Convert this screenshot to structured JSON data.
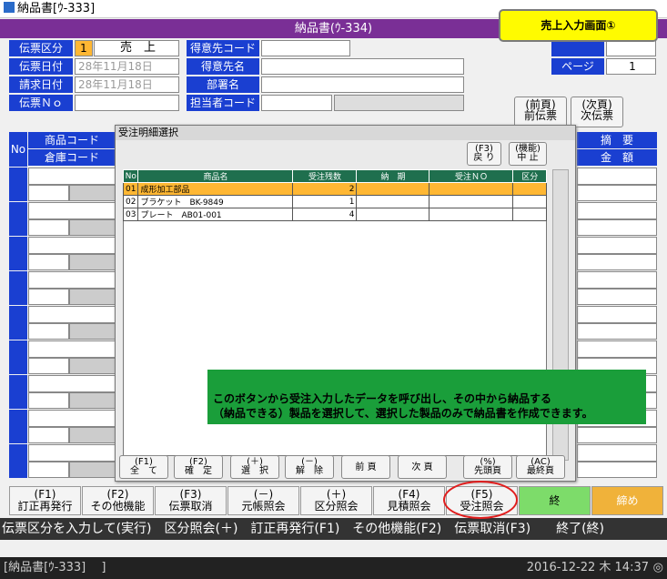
{
  "window": {
    "title": "納品書[ｳ-333]",
    "screen_title": "納品書(ｳ-334)"
  },
  "callout": "売上入力画面①",
  "header": {
    "denpyo_kubun_label": "伝票区分",
    "denpyo_kubun_code": "1",
    "denpyo_kubun_value": "売　上",
    "denpyo_date_label": "伝票日付",
    "denpyo_date_value": "28年11月18日",
    "seikyu_date_label": "請求日付",
    "seikyu_date_value": "28年11月18日",
    "denpyo_no_label": "伝票Ｎｏ",
    "tokuisaki_code_label": "得意先コード",
    "tokuisaki_name_label": "得意先名",
    "busho_label": "部署名",
    "tanto_label": "担当者コード",
    "page_label": "ページ",
    "page_value": "1"
  },
  "nav": {
    "prev_label1": "(前頁)",
    "prev_label2": "前伝票",
    "next_label1": "(次頁)",
    "next_label2": "次伝票"
  },
  "grid": {
    "no": "No",
    "shohin_code": "商品コード",
    "soko_code": "倉庫コード",
    "tekiyo": "摘　要",
    "kingaku": "金　額"
  },
  "dialog": {
    "caption": "受注明細選択",
    "back_key": "(F3)",
    "back_label": "戻 り",
    "cancel_key": "(機能)",
    "cancel_label": "中 止",
    "columns": [
      "No",
      "商品名",
      "受注残数",
      "納　期",
      "受注ＮＯ",
      "区分"
    ],
    "rows": [
      {
        "no": "01",
        "name": "成形加工部品",
        "qty": "2"
      },
      {
        "no": "02",
        "name": "ブラケット　BK-9849",
        "qty": "1"
      },
      {
        "no": "03",
        "name": "プレート　AB01-001",
        "qty": "4"
      }
    ],
    "buttons": [
      {
        "k": "(F1)",
        "l": "全　て"
      },
      {
        "k": "(F2)",
        "l": "確　定"
      },
      {
        "k": "(＋)",
        "l": "選　択"
      },
      {
        "k": "(－)",
        "l": "解　除"
      },
      {
        "k": "",
        "l": "前 頁"
      },
      {
        "k": "",
        "l": "次 頁"
      },
      {
        "k": "(%)",
        "l": "先頭頁"
      },
      {
        "k": "(AC)",
        "l": "最終頁"
      }
    ]
  },
  "note": {
    "line1": "このボタンから受注入力したデータを呼び出し、その中から納品する",
    "line2": "（納品できる）製品を選択して、選択した製品のみで納品書を作成できます。"
  },
  "fkeys": [
    {
      "k": "(F1)",
      "l": "訂正再発行"
    },
    {
      "k": "(F2)",
      "l": "その他機能"
    },
    {
      "k": "(F3)",
      "l": "伝票取消"
    },
    {
      "k": "(－)",
      "l": "元帳照会"
    },
    {
      "k": "(＋)",
      "l": "区分照会"
    },
    {
      "k": "(F4)",
      "l": "見積照会"
    },
    {
      "k": "(F5)",
      "l": "受注照会"
    },
    {
      "k": "",
      "l": "終"
    },
    {
      "k": "",
      "l": "締め"
    }
  ],
  "status": {
    "guide": "伝票区分を入力して(実行)　区分照会(＋)　訂正再発行(F1)　その他機能(F2)　伝票取消(F3)　　終了(終)",
    "window_label": "[納品書[ｳ-333]　 ]",
    "datetime": "2016-12-22 木 14:37"
  },
  "colors": {
    "accent_purple": "#7a2f96",
    "label_blue": "#1a3fd1",
    "header_green": "#1f6f4e",
    "select_orange": "#ffb733",
    "note_green": "#1a9e3a",
    "callout_yellow": "#fffb00",
    "highlight_red": "#e11d1d"
  }
}
